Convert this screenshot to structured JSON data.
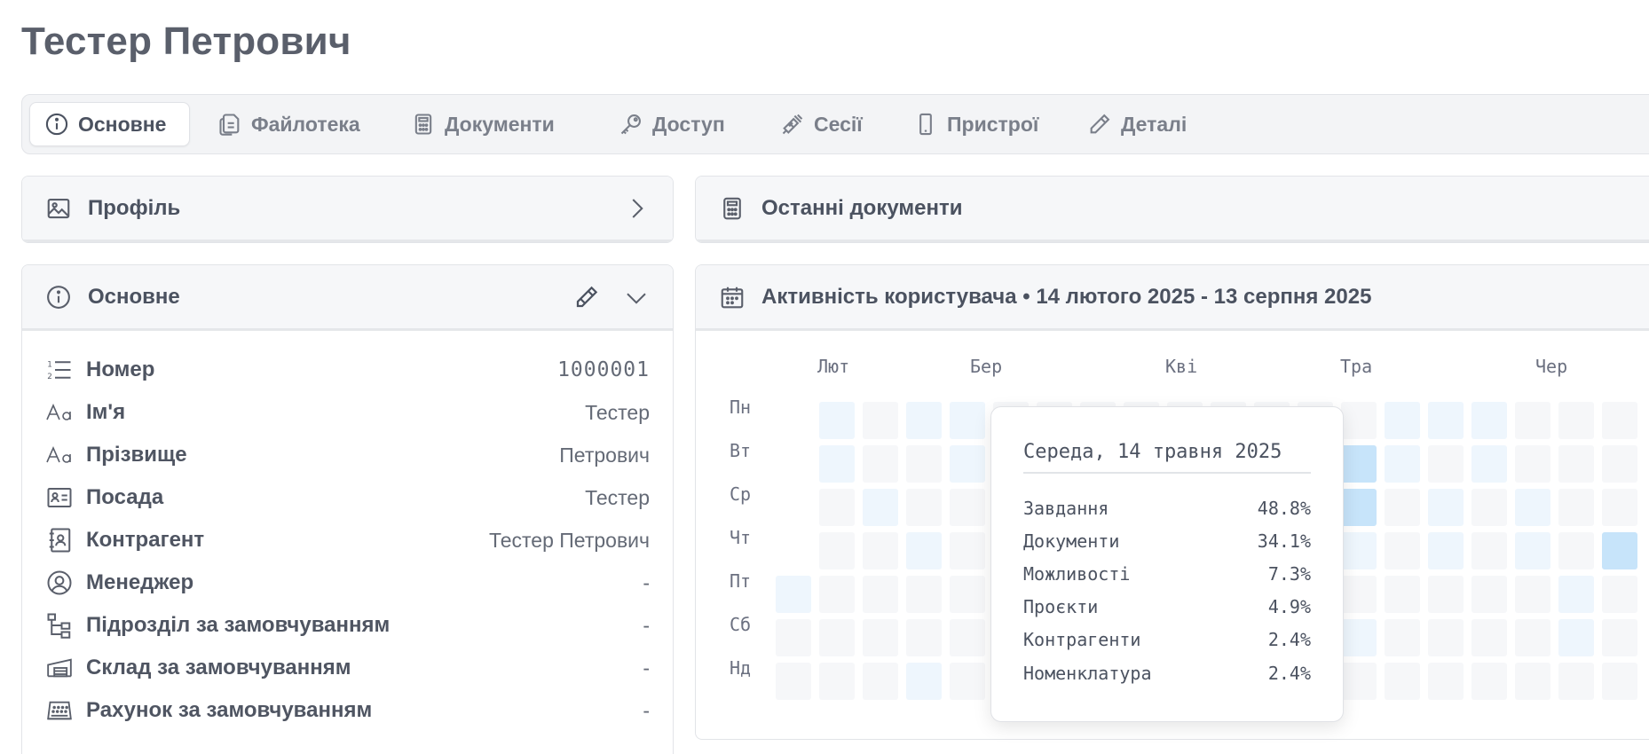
{
  "page": {
    "title": "Тестер Петрович"
  },
  "tabs": [
    {
      "label": "Основне",
      "icon": "info-icon",
      "active": true
    },
    {
      "label": "Файлотека",
      "icon": "files-icon"
    },
    {
      "label": "Документи",
      "icon": "calculator-icon"
    },
    {
      "label": "Доступ",
      "icon": "key-icon"
    },
    {
      "label": "Сесії",
      "icon": "plug-icon"
    },
    {
      "label": "Пристрої",
      "icon": "phone-icon"
    },
    {
      "label": "Деталі",
      "icon": "pencil-icon"
    }
  ],
  "profile_card": {
    "title": "Профіль",
    "icon": "image-icon",
    "action_icon": "chevron-right-icon"
  },
  "main_card": {
    "title": "Основне",
    "icon": "info-icon",
    "rows": [
      {
        "label": "Номер",
        "value": "1000001",
        "icon": "numbered-list-icon"
      },
      {
        "label": "Ім'я",
        "value": "Тестер",
        "icon": "text-icon"
      },
      {
        "label": "Прізвище",
        "value": "Петрович",
        "icon": "text-icon"
      },
      {
        "label": "Посада",
        "value": "Тестер",
        "icon": "id-card-icon"
      },
      {
        "label": "Контрагент",
        "value": "Тестер Петрович",
        "icon": "contact-book-icon"
      },
      {
        "label": "Менеджер",
        "value": "-",
        "icon": "user-circle-icon"
      },
      {
        "label": "Підрозділ за замовчуванням",
        "value": "-",
        "icon": "hierarchy-icon"
      },
      {
        "label": "Склад за замовчуванням",
        "value": "-",
        "icon": "warehouse-icon"
      },
      {
        "label": "Рахунок за замовчуванням",
        "value": "-",
        "icon": "cash-register-icon"
      }
    ]
  },
  "docs_card": {
    "title": "Останні документи",
    "icon": "calculator-icon"
  },
  "activity_card": {
    "title": "Активність користувача • 14 лютого 2025 - 13 серпня 2025",
    "icon": "calendar-icon",
    "months": [
      "Лют",
      "Бер",
      "Кві",
      "Тра",
      "Чер"
    ],
    "days": [
      "Пн",
      "Вт",
      "Ср",
      "Чт",
      "Пт",
      "Сб",
      "Нд"
    ]
  },
  "tooltip": {
    "title": "Середа, 14 травня 2025",
    "rows": [
      {
        "label": "Завдання",
        "value": "48.8%"
      },
      {
        "label": "Документи",
        "value": "34.1%"
      },
      {
        "label": "Можливості",
        "value": "7.3%"
      },
      {
        "label": "Проєкти",
        "value": "4.9%"
      },
      {
        "label": "Контрагенти",
        "value": "2.4%"
      },
      {
        "label": "Номенклатура",
        "value": "2.4%"
      }
    ]
  },
  "colors": {
    "heat_low": "#eef6fd",
    "heat_mid": "#c7e4fa",
    "heat_high": "#56aef0",
    "heat_empty": "#f6f7f9"
  }
}
